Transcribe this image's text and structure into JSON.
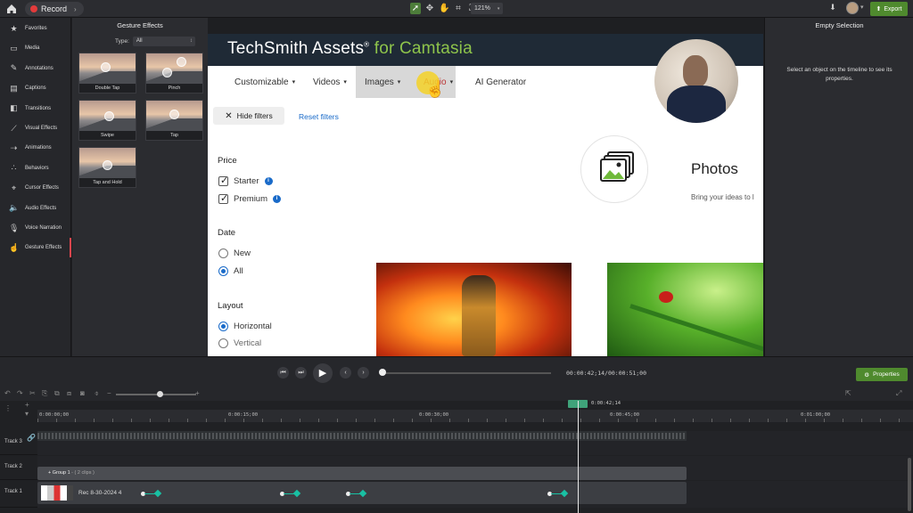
{
  "topbar": {
    "record_label": "Record",
    "zoom": "121%",
    "export_label": "Export"
  },
  "leftnav": {
    "items": [
      {
        "label": "Favorites",
        "icon": "star-icon"
      },
      {
        "label": "Media",
        "icon": "media-icon"
      },
      {
        "label": "Annotations",
        "icon": "annotation-icon"
      },
      {
        "label": "Captions",
        "icon": "captions-icon"
      },
      {
        "label": "Transitions",
        "icon": "transitions-icon"
      },
      {
        "label": "Visual Effects",
        "icon": "wand-icon"
      },
      {
        "label": "Animations",
        "icon": "animation-icon"
      },
      {
        "label": "Behaviors",
        "icon": "behaviors-icon"
      },
      {
        "label": "Cursor Effects",
        "icon": "cursor-icon"
      },
      {
        "label": "Audio Effects",
        "icon": "speaker-icon"
      },
      {
        "label": "Voice Narration",
        "icon": "microphone-icon"
      },
      {
        "label": "Gesture Effects",
        "icon": "hand-icon"
      }
    ],
    "active_index": 11
  },
  "fxpanel": {
    "title": "Gesture Effects",
    "type_label": "Type:",
    "type_value": "All",
    "effects": [
      "Double Tap",
      "Pinch",
      "Swipe",
      "Tap",
      "Tap and Hold"
    ]
  },
  "canvas": {
    "brand_main": "TechSmith Assets",
    "brand_reg": "®",
    "brand_accent": " for Camtasia",
    "nav": [
      "Customizable",
      "Videos",
      "Images",
      "Audio",
      "AI Generator"
    ],
    "hide_filters": "Hide filters",
    "reset_filters": "Reset filters",
    "price_title": "Price",
    "price_options": [
      "Starter",
      "Premium"
    ],
    "date_title": "Date",
    "date_options": [
      "New",
      "All"
    ],
    "layout_title": "Layout",
    "layout_options": [
      "Horizontal",
      "Vertical"
    ],
    "photos_title": "Photos",
    "photos_sub": "Bring your ideas to l"
  },
  "rightpanel": {
    "title": "Empty Selection",
    "message": "Select an object on the timeline to see its properties."
  },
  "playback": {
    "timecode": "00:00:42;14/00:00:51;00",
    "properties_label": "Properties",
    "progress": 0.0
  },
  "timeline": {
    "ruler": [
      "0:00:00;00",
      "0:00:15;00",
      "0:00:30;00",
      "0:00:45;00",
      "0:01:00;00"
    ],
    "playhead_time": "0:00:42;14",
    "tracks": [
      "Track 3",
      "Track 2",
      "Track 1"
    ],
    "group_name": "Group 1",
    "group_sub": "- ( 2 clips )",
    "clip_name": "Rec 8-30-2024 4"
  }
}
